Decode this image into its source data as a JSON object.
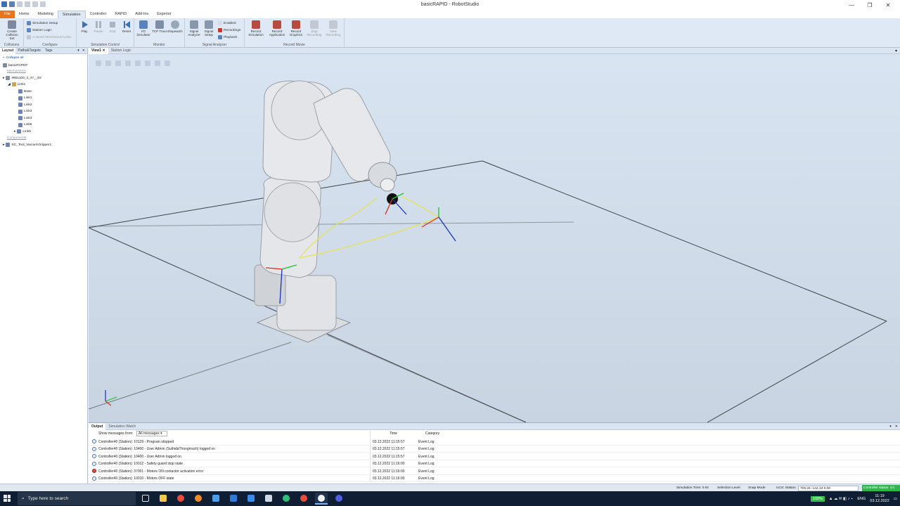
{
  "window": {
    "title": "basicRAPID - RobotStudio",
    "controls": [
      "—",
      "❐",
      "✕"
    ]
  },
  "ribbon_tabs": [
    "File",
    "Home",
    "Modeling",
    "Simulation",
    "Controller",
    "RAPID",
    "Add-Ins",
    "Experior"
  ],
  "ribbon": {
    "collisions": {
      "create": "Create Collision Set",
      "label": "Collisions"
    },
    "configure": {
      "setup": "Simulation Setup",
      "station_logic": "Station Logic",
      "activate": "Activate Mechanical Units",
      "label": "Configure"
    },
    "sim_control": {
      "play": "Play",
      "pause": "Pause",
      "stop": "Stop",
      "reset": "Reset",
      "label": "Simulation Control"
    },
    "monitor": {
      "io": "I/O Simulator",
      "tcp": "TCP Trace",
      "stopwatch": "Stopwatch",
      "label": "Monitor"
    },
    "signal_analyzer": {
      "analyzer": "Signal Analyzer",
      "setup": "Signal Setup",
      "enabled": "Enabled",
      "recordings": "Recordings",
      "playback": "Playback",
      "label": "Signal Analyzer"
    },
    "record_movie": {
      "record_sim": "Record Simulation",
      "record_app": "Record Application",
      "record_graphics": "Record Graphics",
      "stop_rec": "Stop Recording",
      "view_rec": "View Recording",
      "label": "Record Movie"
    }
  },
  "left_panel": {
    "tabs": [
      "Layout",
      "Paths&Targets",
      "Tags"
    ],
    "collapse_all": "Collapse all",
    "tree": {
      "station": "basicRAPID*",
      "mechanisms_header": "Mechanisms",
      "robot": "IRB1100_4_47__02",
      "links_folder": "Links",
      "links": [
        "Base",
        "Link1",
        "Link2",
        "Link3",
        "Link4",
        "Link5",
        "Link6"
      ],
      "components_header": "Components",
      "tool": "SC_Tool_VacuumGripper1"
    }
  },
  "view_tabs": [
    "View1",
    "Station Logic"
  ],
  "output": {
    "tabs": [
      "Output",
      "Simulation Watch"
    ],
    "show_label": "Show messages from:",
    "filter_value": "All messages",
    "col_time": "Time",
    "col_category": "Category",
    "messages": [
      {
        "msg": "Controller40 (Station): 10129 - Program stopped",
        "time": "03.12.2022 11:15:57",
        "cat": "Event Log",
        "level": "info"
      },
      {
        "msg": "Controller40 (Station): 10400 - User Admin (SuthidaThongmuch) logged on",
        "time": "03.12.2022 11:15:57",
        "cat": "Event Log",
        "level": "info"
      },
      {
        "msg": "Controller40 (Station): 10400 - User Admin logged on",
        "time": "03.12.2022 11:15:57",
        "cat": "Event Log",
        "level": "info"
      },
      {
        "msg": "Controller40 (Station): 10012 - Safety guard stop state",
        "time": "03.12.2022 11:16:00",
        "cat": "Event Log",
        "level": "info"
      },
      {
        "msg": "Controller40 (Station): 37001 - Motors ON contactor activation error",
        "time": "03.12.2022 11:16:00",
        "cat": "Event Log",
        "level": "error"
      },
      {
        "msg": "Controller40 (Station): 10010 - Motors OFF state",
        "time": "03.12.2022 11:16:00",
        "cat": "Event Log",
        "level": "info"
      }
    ]
  },
  "status_bar": {
    "sim_time": "Simulation Time: 0.0s",
    "selection_level": "Selection Level",
    "snap_mode": "Snap Mode",
    "ucs_label": "UCS: Station",
    "ucs_value": "709,26 -142,13 0,00",
    "controller_status": "Controller status: 1/1"
  },
  "taskbar": {
    "search_placeholder": "Type here to search",
    "battery": "100%",
    "lang": "ENG",
    "time": "11:19",
    "date": "03.12.2022"
  },
  "colors": {
    "accent": "#e8751a",
    "ribbon_bg": "#dfe9f5",
    "status_green": "#2eb84b",
    "error_red": "#d2392f"
  }
}
